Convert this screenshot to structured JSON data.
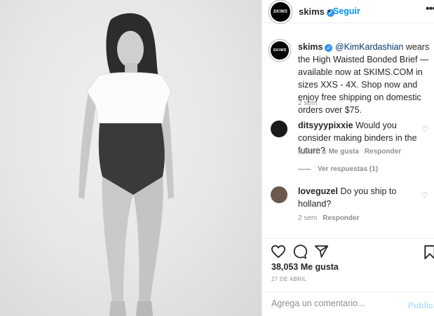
{
  "header": {
    "avatar_text": "SKIMS",
    "username": "skims",
    "separator": "•",
    "follow_label": "Seguir",
    "more_label": "•••"
  },
  "caption": {
    "username": "skims",
    "mention": "@KimKardashian",
    "text": " wears the High Waisted Bonded Brief — available now at SKIMS.COM in sizes XXS - 4X. Shop now and enjoy free shipping on domestic orders over $75.",
    "time": "2 sem"
  },
  "comments": [
    {
      "username": "ditsyyypixxie",
      "text": " Would you consider making binders in the future?",
      "time": "2 sem",
      "likes": "1 Me gusta",
      "reply_label": "Responder",
      "view_replies": "Ver respuestas (1)"
    },
    {
      "username": "loveguzel",
      "text": " Do you ship to holland?",
      "time": "2 sem",
      "reply_label": "Responder"
    }
  ],
  "icons": {
    "like": "heart-icon",
    "comment": "comment-bubble-icon",
    "share": "paper-plane-icon",
    "save": "bookmark-icon"
  },
  "stats": {
    "likes": "38,053 Me gusta",
    "date": "27 DE ABRIL"
  },
  "add_comment": {
    "placeholder": "Agrega un comentario...",
    "publish_label": "Publicar"
  },
  "colors": {
    "link_blue": "#0095f6",
    "verified_blue": "#3897f0",
    "muted": "#8e8e8e"
  }
}
